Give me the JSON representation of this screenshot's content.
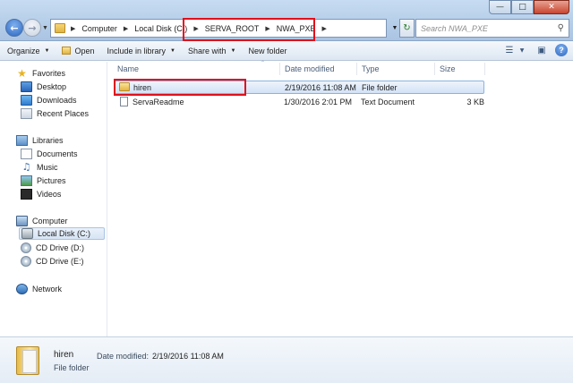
{
  "address_bar": {
    "crumbs": [
      "Computer",
      "Local Disk (C:)",
      "SERVA_ROOT",
      "NWA_PXE"
    ],
    "search_placeholder": "Search NWA_PXE"
  },
  "toolbar": {
    "organize": "Organize",
    "open": "Open",
    "include_in_library": "Include in library",
    "share_with": "Share with",
    "new_folder": "New folder"
  },
  "navigation": {
    "favorites": {
      "label": "Favorites",
      "items": [
        "Desktop",
        "Downloads",
        "Recent Places"
      ]
    },
    "libraries": {
      "label": "Libraries",
      "items": [
        "Documents",
        "Music",
        "Pictures",
        "Videos"
      ]
    },
    "computer": {
      "label": "Computer",
      "items": [
        "Local Disk (C:)",
        "CD Drive (D:)",
        "CD Drive (E:)"
      ],
      "selected": "Local Disk (C:)"
    },
    "network": {
      "label": "Network"
    }
  },
  "file_list": {
    "columns": [
      "Name",
      "Date modified",
      "Type",
      "Size"
    ],
    "rows": [
      {
        "name": "hiren",
        "date": "2/19/2016 11:08 AM",
        "type": "File folder",
        "size": "",
        "icon": "folder-icon",
        "selected": true
      },
      {
        "name": "ServaReadme",
        "date": "1/30/2016 2:01 PM",
        "type": "Text Document",
        "size": "3 KB",
        "icon": "text-document-icon",
        "selected": false
      }
    ]
  },
  "details_pane": {
    "name": "hiren",
    "date_label": "Date modified:",
    "date_value": "2/19/2016 11:08 AM",
    "type": "File folder"
  },
  "colors": {
    "highlight": "#e0101a",
    "selection": "#d2e2f6",
    "window_frame": "#b5cde8"
  }
}
